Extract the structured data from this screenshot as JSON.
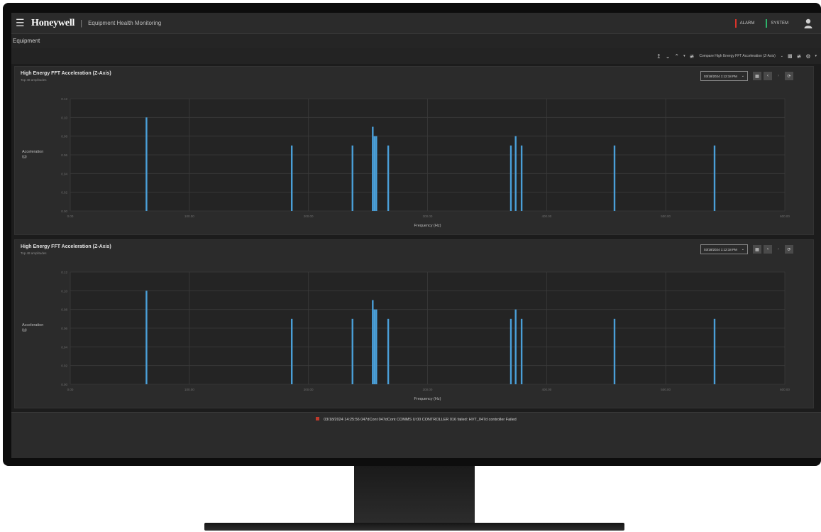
{
  "header": {
    "brand": "Honeywell",
    "separator": "|",
    "app_title": "Equipment Health Monitoring",
    "alarm_label": "ALARM",
    "system_label": "SYSTEM",
    "alarm_color": "#d9342b",
    "system_color": "#2db36b"
  },
  "breadcrumb": {
    "label": "Equipment"
  },
  "toolbar": {
    "compare_label": "Compare High Energy FFT Acceleration (Z-Axis)"
  },
  "panels": [
    {
      "title": "High Energy FFT Acceleration (Z-Axis)",
      "subtitle": "Top 48 amplitudes",
      "date": "03/18/2024 1:12:18 PM"
    },
    {
      "title": "High Energy FFT Acceleration (Z-Axis)",
      "subtitle": "Top 48 amplitudes",
      "date": "03/18/2024 1:12:18 PM"
    }
  ],
  "chart_data": [
    {
      "type": "bar",
      "title": "High Energy FFT Acceleration (Z-Axis)",
      "xlabel": "Frequency (Hz)",
      "ylabel": "Acceleration (g)",
      "xlim": [
        0,
        600
      ],
      "ylim": [
        0,
        0.12
      ],
      "x_ticks": [
        "0.00",
        "100.00",
        "200.00",
        "300.00",
        "400.00",
        "500.00",
        "600.00"
      ],
      "y_ticks": [
        "0.00",
        "0.02",
        "0.04",
        "0.06",
        "0.08",
        "0.10",
        "0.12"
      ],
      "bar_color": "#4a9fd8",
      "x": [
        64,
        186,
        237,
        254,
        255.5,
        257,
        267,
        370,
        374,
        379,
        457,
        541
      ],
      "values": [
        0.1,
        0.07,
        0.07,
        0.09,
        0.08,
        0.08,
        0.07,
        0.07,
        0.08,
        0.07,
        0.07,
        0.07
      ]
    },
    {
      "type": "bar",
      "title": "High Energy FFT Acceleration (Z-Axis)",
      "xlabel": "Frequency (Hz)",
      "ylabel": "Acceleration (g)",
      "xlim": [
        0,
        600
      ],
      "ylim": [
        0,
        0.12
      ],
      "x_ticks": [
        "0.00",
        "100.00",
        "200.00",
        "300.00",
        "400.00",
        "500.00",
        "600.00"
      ],
      "y_ticks": [
        "0.00",
        "0.02",
        "0.04",
        "0.06",
        "0.08",
        "0.10",
        "0.12"
      ],
      "bar_color": "#4a9fd8",
      "x": [
        64,
        186,
        237,
        254,
        255.5,
        257,
        267,
        370,
        374,
        379,
        457,
        541
      ],
      "values": [
        0.1,
        0.07,
        0.07,
        0.09,
        0.08,
        0.08,
        0.07,
        0.07,
        0.08,
        0.07,
        0.07,
        0.07
      ]
    }
  ],
  "footer": {
    "alarm_text": "03/18/2024 14:25:56  047dCont  047dCont  COMMS  U:00  CONTROLLER 016 failed: HVT_047d controller  Failed"
  }
}
